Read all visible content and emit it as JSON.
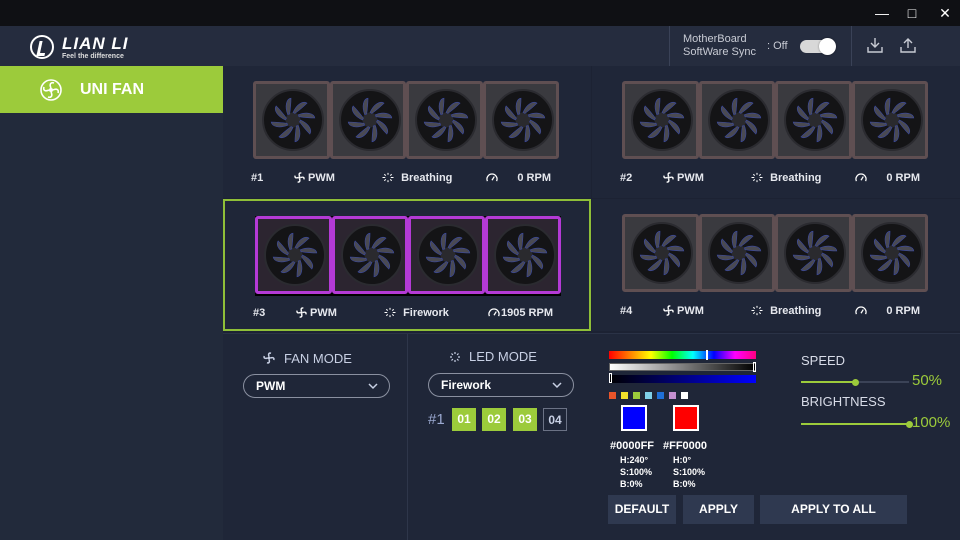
{
  "window": {
    "minimize_icon": "minimize-icon",
    "maximize_icon": "maximize-icon",
    "close_icon": "close-icon"
  },
  "header": {
    "logo_text": "LIAN LI",
    "logo_tagline": "Feel the difference",
    "motherboard_sync_label_line1": "MotherBoard",
    "motherboard_sync_label_line2": "SoftWare Sync",
    "motherboard_sync_state": ": Off",
    "toggle_on": true,
    "import_icon": "download-icon",
    "export_icon": "upload-icon"
  },
  "sidebar": {
    "items": [
      {
        "label": "UNI FAN",
        "icon": "fan-icon",
        "active": true
      }
    ]
  },
  "groups": [
    {
      "id": "#1",
      "fan_mode": "PWM",
      "led_mode": "Breathing",
      "rpm": "0 RPM",
      "selected": false
    },
    {
      "id": "#2",
      "fan_mode": "PWM",
      "led_mode": "Breathing",
      "rpm": "0 RPM",
      "selected": false
    },
    {
      "id": "#3",
      "fan_mode": "PWM",
      "led_mode": "Firework",
      "rpm": "1905 RPM",
      "selected": true
    },
    {
      "id": "#4",
      "fan_mode": "PWM",
      "led_mode": "Breathing",
      "rpm": "0 RPM",
      "selected": false
    }
  ],
  "fan_mode": {
    "title": "FAN MODE",
    "value": "PWM"
  },
  "led_mode": {
    "title": "LED MODE",
    "value": "Firework",
    "group_label": "#1",
    "zones": [
      {
        "label": "01",
        "active": true
      },
      {
        "label": "02",
        "active": true
      },
      {
        "label": "03",
        "active": true
      },
      {
        "label": "04",
        "active": false
      }
    ]
  },
  "color": {
    "preset_swatches": [
      "#e8542a",
      "#f2e02b",
      "#9ccb3b",
      "#7fd0e8",
      "#1f6fd6",
      "#c58fd0",
      "#ffffff"
    ],
    "color1": {
      "hex": "#0000FF",
      "h": "H:240°",
      "s": "S:100%",
      "b": "B:0%"
    },
    "color2": {
      "hex": "#FF0000",
      "h": "H:0°",
      "s": "S:100%",
      "b": "B:0%"
    }
  },
  "buttons": {
    "default": "DEFAULT",
    "apply": "APPLY",
    "apply_all": "APPLY TO ALL"
  },
  "speed": {
    "label": "SPEED",
    "value": "50%",
    "fraction": 0.5
  },
  "brightness": {
    "label": "BRIGHTNESS",
    "value": "100%",
    "fraction": 1.0
  }
}
